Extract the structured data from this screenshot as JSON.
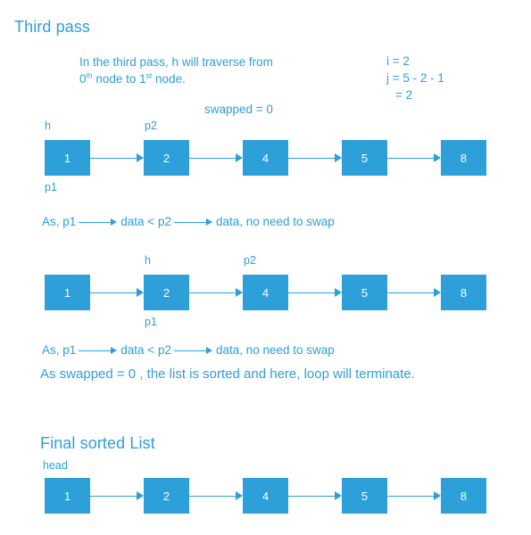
{
  "page": {
    "title": "Third pass",
    "accent_color": "#2e9fd9",
    "node_fill": "#2ea0d9",
    "node_text_color": "#ffffff"
  },
  "description": {
    "line1_prefix": "In the third pass, h will traverse from",
    "line2_a": "0",
    "line2_a_sup": "th",
    "line2_b": " node to 1",
    "line2_b_sup": "st",
    "line2_c": " node."
  },
  "swapped_label": "swapped = 0",
  "calc": {
    "line1": "i = 2",
    "line2": "j = 5 - 2 - 1",
    "line3": "= 2"
  },
  "diagrams": [
    {
      "name": "first-comparison-list",
      "values": [
        "1",
        "2",
        "4",
        "5",
        "8"
      ],
      "labels_above": [
        {
          "text": "h",
          "node_index": 0
        },
        {
          "text": "p2",
          "node_index": 1
        }
      ],
      "labels_below": [
        {
          "text": "p1",
          "node_index": 0
        }
      ]
    },
    {
      "name": "second-comparison-list",
      "values": [
        "1",
        "2",
        "4",
        "5",
        "8"
      ],
      "labels_above": [
        {
          "text": "h",
          "node_index": 1
        },
        {
          "text": "p2",
          "node_index": 2
        }
      ],
      "labels_below": [
        {
          "text": "p1",
          "node_index": 1
        }
      ]
    },
    {
      "name": "final-sorted-list",
      "values": [
        "1",
        "2",
        "4",
        "5",
        "8"
      ],
      "labels_above": [
        {
          "text": "head",
          "node_index": 0
        }
      ],
      "labels_below": []
    }
  ],
  "comparison_sentence": {
    "part1": "As,  p1",
    "part2": "data < p2",
    "part3": "data,  no need to swap"
  },
  "conclusion": {
    "text": "As swapped  =  0 ,  the list is sorted and here, loop will terminate."
  },
  "final_heading": "Final sorted List"
}
